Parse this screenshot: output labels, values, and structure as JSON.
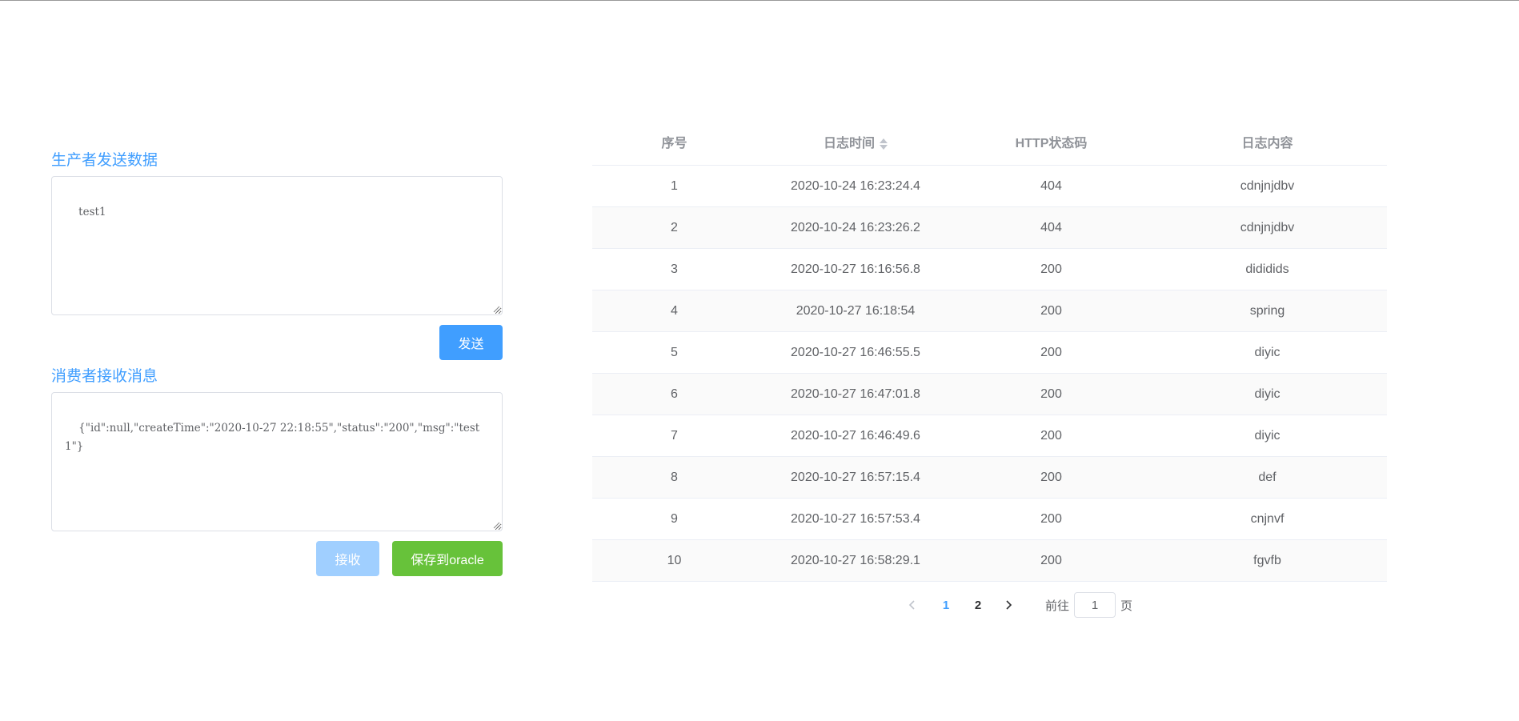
{
  "producer": {
    "title": "生产者发送数据",
    "content": "test1",
    "send_label": "发送"
  },
  "consumer": {
    "title": "消费者接收消息",
    "content": "{\"id\":null,\"createTime\":\"2020-10-27 22:18:55\",\"status\":\"200\",\"msg\":\"test1\"}",
    "receive_label": "接收",
    "save_label": "保存到oracle"
  },
  "table": {
    "headers": [
      "序号",
      "日志时间",
      "HTTP状态码",
      "日志内容"
    ],
    "rows": [
      [
        "1",
        "2020-10-24 16:23:24.4",
        "404",
        "cdnjnjdbv"
      ],
      [
        "2",
        "2020-10-24 16:23:26.2",
        "404",
        "cdnjnjdbv"
      ],
      [
        "3",
        "2020-10-27 16:16:56.8",
        "200",
        "dididids"
      ],
      [
        "4",
        "2020-10-27 16:18:54",
        "200",
        "spring"
      ],
      [
        "5",
        "2020-10-27 16:46:55.5",
        "200",
        "diyic"
      ],
      [
        "6",
        "2020-10-27 16:47:01.8",
        "200",
        "diyic"
      ],
      [
        "7",
        "2020-10-27 16:46:49.6",
        "200",
        "diyic"
      ],
      [
        "8",
        "2020-10-27 16:57:15.4",
        "200",
        "def"
      ],
      [
        "9",
        "2020-10-27 16:57:53.4",
        "200",
        "cnjnvf"
      ],
      [
        "10",
        "2020-10-27 16:58:29.1",
        "200",
        "fgvfb"
      ]
    ]
  },
  "pagination": {
    "pages": [
      "1",
      "2"
    ],
    "current": "1",
    "goto_prefix": "前往",
    "goto_value": "1",
    "goto_suffix": "页"
  },
  "colors": {
    "primary": "#409eff",
    "success": "#67c23a",
    "disabled": "#a0cfff"
  },
  "icons": [
    "sort-caret-icon",
    "chevron-left-icon",
    "chevron-right-icon",
    "resize-grip-icon"
  ]
}
